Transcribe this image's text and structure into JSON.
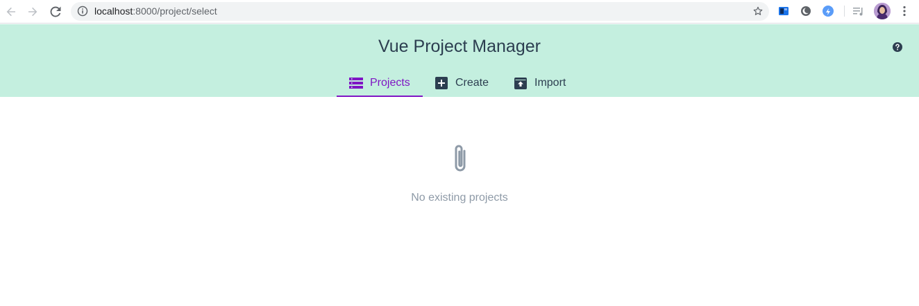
{
  "browser": {
    "url_host": "localhost",
    "url_rest": ":8000/project/select",
    "icons": {
      "back": "arrow-left-icon",
      "forward": "arrow-right-icon",
      "reload": "reload-icon",
      "info": "info-icon",
      "bookmark": "star-icon",
      "menu": "kebab-menu-icon"
    }
  },
  "header": {
    "title": "Vue Project Manager",
    "help_icon": "help-icon",
    "tabs": [
      {
        "label": "Projects",
        "icon": "list-icon",
        "active": true
      },
      {
        "label": "Create",
        "icon": "plus-box-icon",
        "active": false
      },
      {
        "label": "Import",
        "icon": "unarchive-icon",
        "active": false
      }
    ]
  },
  "main": {
    "empty_icon": "paperclip-icon",
    "empty_message": "No existing projects"
  },
  "colors": {
    "header_bg": "#c4efdf",
    "accent": "#7f15c4",
    "text": "#2c3e50",
    "muted": "#8e9aa7"
  }
}
